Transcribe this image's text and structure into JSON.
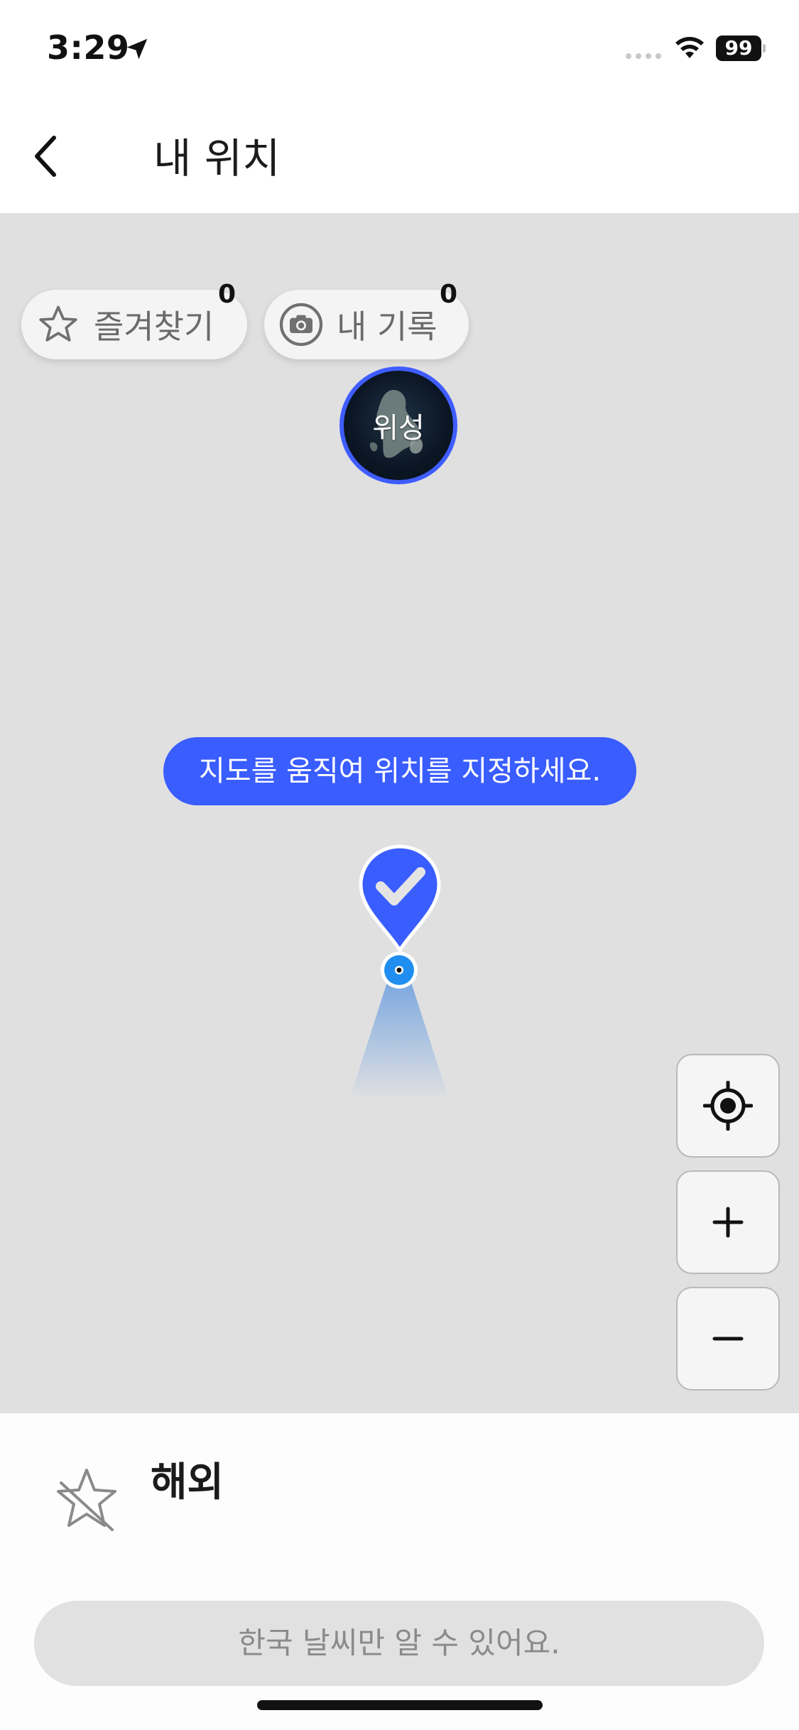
{
  "status_bar": {
    "time": "3:29",
    "battery": "99"
  },
  "header": {
    "title": "내 위치"
  },
  "map": {
    "satellite_label": "위성",
    "chips": {
      "favorites": {
        "label": "즐겨찾기",
        "count": "0"
      },
      "records": {
        "label": "내 기록",
        "count": "0"
      }
    },
    "hint": "지도를 움직여 위치를 지정하세요.",
    "accent_color": "#3a5dff"
  },
  "controls": {
    "locate_icon": "crosshair-icon",
    "zoom_in_icon": "plus-icon",
    "zoom_out_icon": "minus-icon"
  },
  "bottom": {
    "region_name": "해외",
    "notice": "한국 날씨만 알 수 있어요."
  }
}
